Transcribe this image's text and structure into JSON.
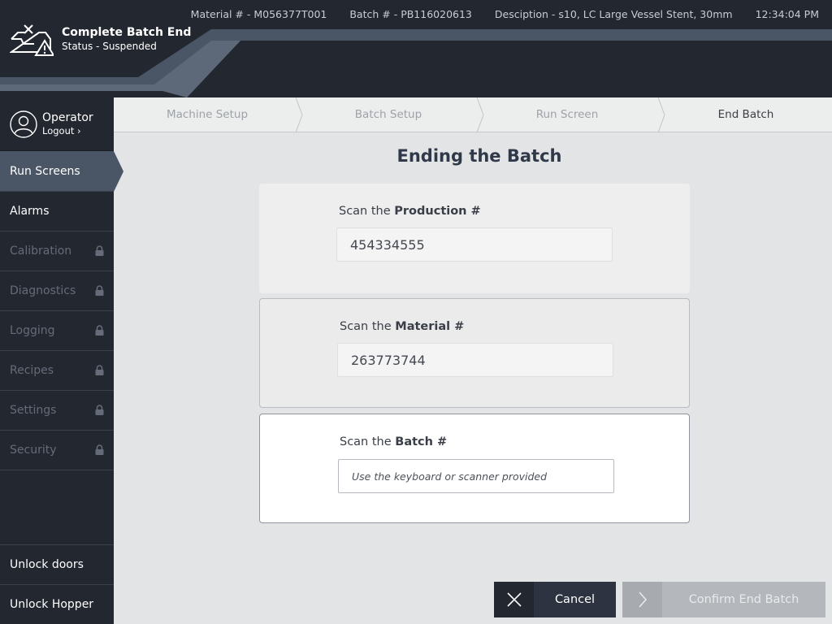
{
  "header": {
    "material": "Material # - M056377T001",
    "batch": "Batch # - PB116020613",
    "description": "Desciption - s10, LC Large Vessel Stent, 30mm",
    "time": "12:34:04 PM",
    "title": "Complete Batch End",
    "status": "Status - Suspended",
    "title_icon": "inbox-warning-icon"
  },
  "operator": {
    "name": "Operator",
    "logout": "Logout",
    "logout_chevron": "›"
  },
  "sidebar": {
    "items": [
      {
        "label": "Run Screens",
        "state": "active"
      },
      {
        "label": "Alarms",
        "state": "enabled"
      },
      {
        "label": "Calibration",
        "state": "locked"
      },
      {
        "label": "Diagnostics",
        "state": "locked"
      },
      {
        "label": "Logging",
        "state": "locked"
      },
      {
        "label": "Recipes",
        "state": "locked"
      },
      {
        "label": "Settings",
        "state": "locked"
      },
      {
        "label": "Security",
        "state": "locked"
      }
    ],
    "bottom": [
      {
        "label": "Unlock doors"
      },
      {
        "label": "Unlock Hopper"
      }
    ]
  },
  "steps": [
    {
      "label": "Machine Setup",
      "current": false
    },
    {
      "label": "Batch Setup",
      "current": false
    },
    {
      "label": "Run Screen",
      "current": false
    },
    {
      "label": "End Batch",
      "current": true
    }
  ],
  "main": {
    "title": "Ending the Batch",
    "production": {
      "prefix": "Scan the ",
      "bold": "Production #",
      "value": "454334555"
    },
    "material": {
      "prefix": "Scan the ",
      "bold": "Material #",
      "value": "263773744"
    },
    "batch": {
      "prefix": "Scan the ",
      "bold": "Batch #",
      "value": "",
      "placeholder": "Use the keyboard or scanner provided"
    }
  },
  "buttons": {
    "cancel": "Cancel",
    "confirm": "Confirm End Batch"
  },
  "colors": {
    "header_bg": "#232730",
    "accent_band": "#4a5566",
    "sidebar_active": "#4a5566",
    "title_text": "#2f3949"
  }
}
